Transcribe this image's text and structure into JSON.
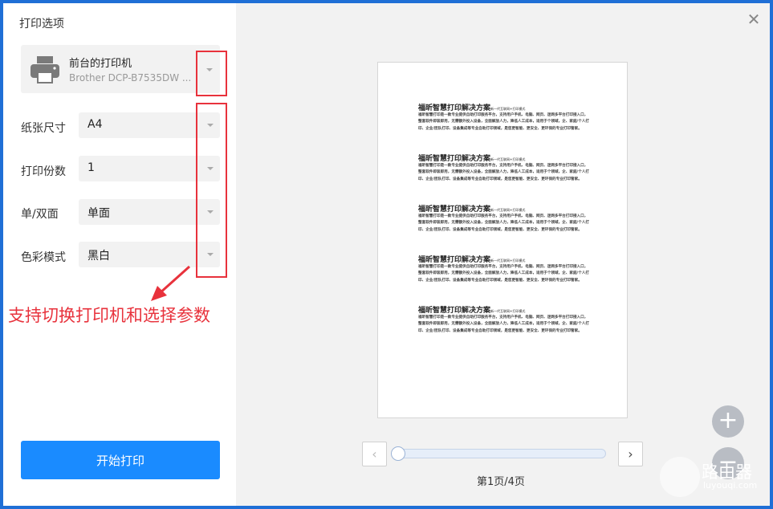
{
  "dialog": {
    "title": "打印选项",
    "close_icon": "close-icon"
  },
  "printer": {
    "name": "前台的打印机",
    "model": "Brother DCP-B7535DW ...",
    "icon": "printer-icon"
  },
  "settings": [
    {
      "label": "纸张尺寸",
      "value": "A4"
    },
    {
      "label": "打印份数",
      "value": "1"
    },
    {
      "label": "单/双面",
      "value": "单面"
    },
    {
      "label": "色彩模式",
      "value": "黑白"
    }
  ],
  "annotation": {
    "text": "支持切换打印机和选择参数",
    "color": "#e8323c"
  },
  "print_button": {
    "label": "开始打印",
    "color": "#1a8bff"
  },
  "preview": {
    "blocks": [
      {
        "heading": "福昕智慧打印解决方案",
        "subheading": "新一代互联网+打印模式",
        "body": "福昕智慧打印是一款专业提供自助打印服务平台，支持用户手机、电脑、网页、迷网多平台打印接入口，整套软件即装即用，无需额外投入设备，全面解放人力，降低人工成本，适用于个领域，企、家庭/个人打印、企业/团队打印、设备集成等专业自助打印领域，是您更智能、更安全、更环保的专业打印管家。"
      },
      {
        "heading": "福昕智慧打印解决方案",
        "subheading": "新一代互联网+打印模式",
        "body": "福昕智慧打印是一款专业提供自助打印服务平台，支持用户手机、电脑、网页、迷网多平台打印接入口，整套软件即装即用，无需额外投入设备，全面解放人力，降低人工成本，适用于个领域，企、家庭/个人打印、企业/团队打印、设备集成等专业自助打印领域，是您更智能、更安全、更环保的专业打印管家。"
      },
      {
        "heading": "福昕智慧打印解决方案",
        "subheading": "新一代互联网+打印模式",
        "body": "福昕智慧打印是一款专业提供自助打印服务平台，支持用户手机、电脑、网页、迷网多平台打印接入口，整套软件即装即用，无需额外投入设备，全面解放人力，降低人工成本，适用于个领域，企、家庭/个人打印、企业/团队打印、设备集成等专业自助打印领域，是您更智能、更安全、更环保的专业打印管家。"
      },
      {
        "heading": "福昕智慧打印解决方案",
        "subheading": "新一代互联网+打印模式",
        "body": "福昕智慧打印是一款专业提供自助打印服务平台，支持用户手机、电脑、网页、迷网多平台打印接入口，整套软件即装即用，无需额外投入设备，全面解放人力，降低人工成本，适用于个领域，企、家庭/个人打印、企业/团队打印、设备集成等专业自助打印领域，是您更智能、更安全、更环保的专业打印管家。"
      },
      {
        "heading": "福昕智慧打印解决方案",
        "subheading": "新一代互联网+打印模式",
        "body": "福昕智慧打印是一款专业提供自助打印服务平台，支持用户手机、电脑、网页、迷网多平台打印接入口，整套软件即装即用，无需额外投入设备，全面解放人力，降低人工成本，适用于个领域，企、家庭/个人打印、企业/团队打印、设备集成等专业自助打印领域，是您更智能、更安全、更环保的专业打印管家。"
      }
    ],
    "page_indicator": "第1页/4页",
    "current_page": 1,
    "total_pages": 4
  },
  "zoom": {
    "in_icon": "plus-icon",
    "out_icon": "minus-icon"
  },
  "watermark": {
    "text": "路由器",
    "sub": "luyouqi.com"
  }
}
